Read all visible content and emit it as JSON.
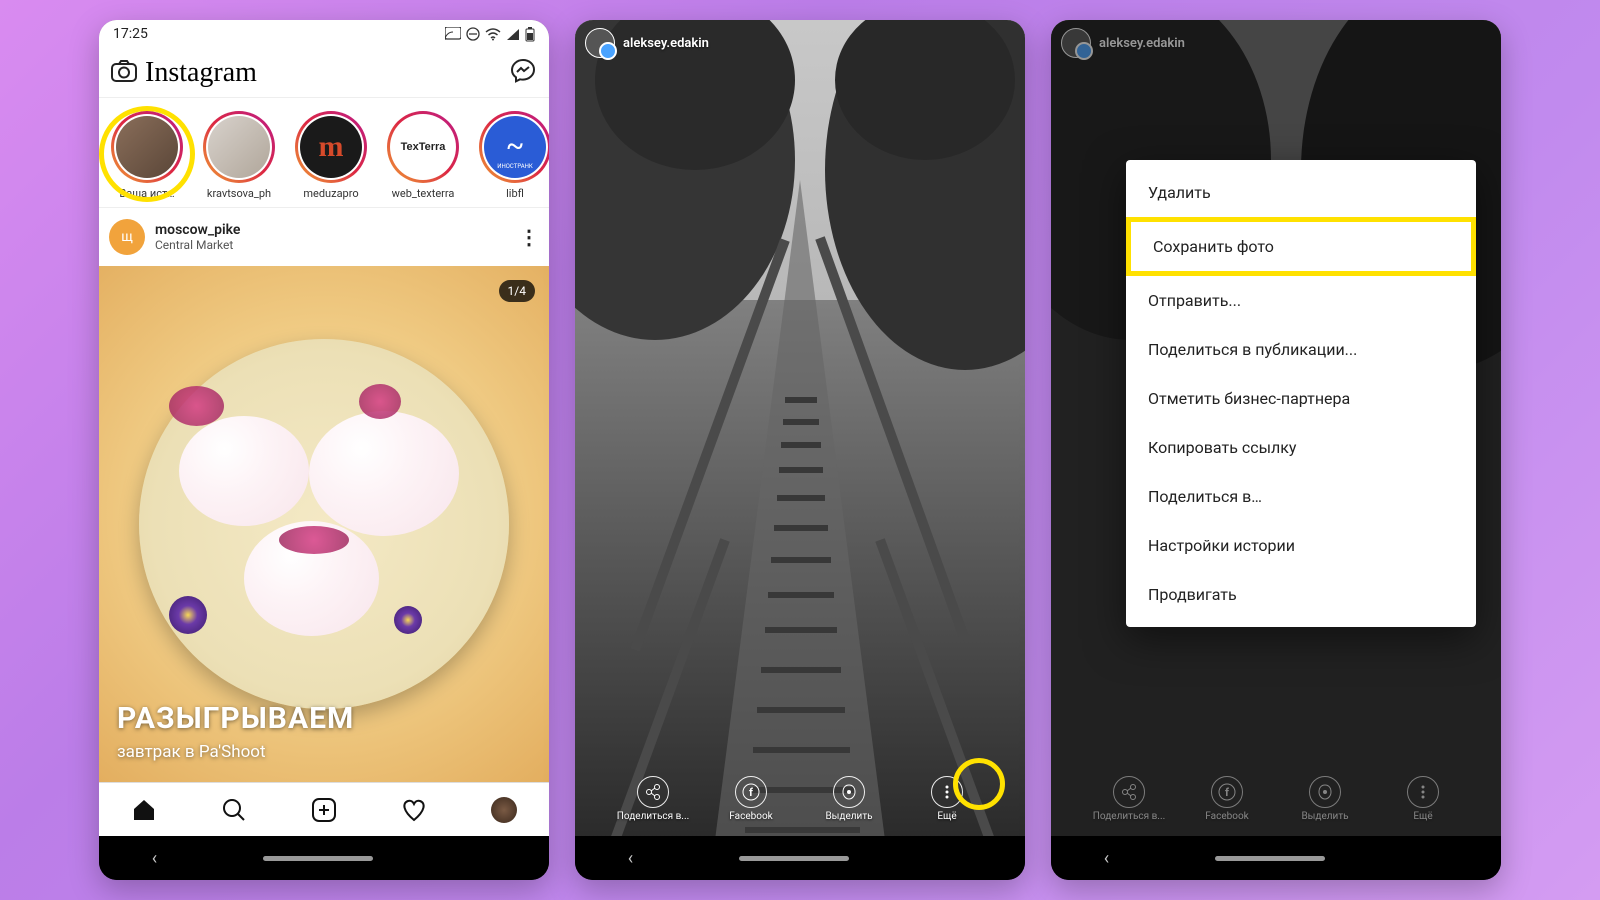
{
  "status": {
    "time": "17:25"
  },
  "header": {
    "logo": "Instagram"
  },
  "stories": [
    {
      "label": "Ваша ист…",
      "bg": "linear-gradient(135deg,#8a6e5a,#5a4638)"
    },
    {
      "label": "kravtsova_ph",
      "bg": "linear-gradient(135deg,#d8d2cc,#b0a69a)"
    },
    {
      "label": "meduzapro",
      "bg": "#1a1a1a",
      "text": "m",
      "textColor": "#d64a2a"
    },
    {
      "label": "web_texterra",
      "bg": "#ffffff",
      "text": "TexTerra",
      "textColor": "#222"
    },
    {
      "label": "libfl",
      "bg": "#2a5cd6",
      "text": "~",
      "textColor": "#fff",
      "badge": "ИНОСТРАНК"
    }
  ],
  "post": {
    "avatar_initial": "щ",
    "user": "moscow_pike",
    "location": "Central Market",
    "counter": "1/4",
    "overlay_big": "РАЗЫГРЫВАЕМ",
    "overlay_small": "завтрак в Pa'Shoot"
  },
  "story_user": "aleksey.edakin",
  "story_actions": [
    {
      "label": "Поделиться в..."
    },
    {
      "label": "Facebook"
    },
    {
      "label": "Выделить"
    },
    {
      "label": "Ещё"
    }
  ],
  "menu": [
    "Удалить",
    "Сохранить фото",
    "Отправить...",
    "Поделиться в публикации...",
    "Отметить бизнес-партнера",
    "Копировать ссылку",
    "Поделиться в…",
    "Настройки истории",
    "Продвигать"
  ]
}
